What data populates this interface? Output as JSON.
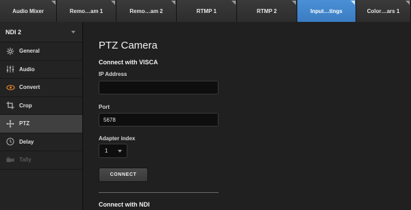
{
  "tabs": [
    {
      "label": "Audio Mixer",
      "active": false
    },
    {
      "label": "Remo…am 1",
      "active": false
    },
    {
      "label": "Remo…am 2",
      "active": false
    },
    {
      "label": "RTMP 1",
      "active": false
    },
    {
      "label": "RTMP 2",
      "active": false
    },
    {
      "label": "Input…tings",
      "active": true
    },
    {
      "label": "Color…ars 1",
      "active": false
    }
  ],
  "sidebar": {
    "source": "NDI 2",
    "items": [
      {
        "label": "General",
        "icon": "gear-icon"
      },
      {
        "label": "Audio",
        "icon": "audio-sliders-icon"
      },
      {
        "label": "Convert",
        "icon": "convert-icon"
      },
      {
        "label": "Crop",
        "icon": "crop-icon"
      },
      {
        "label": "PTZ",
        "icon": "ptz-move-icon",
        "active": true
      },
      {
        "label": "Delay",
        "icon": "clock-icon"
      },
      {
        "label": "Tally",
        "icon": "camera-icon",
        "disabled": true
      }
    ]
  },
  "main": {
    "title": "PTZ Camera",
    "visca_heading": "Connect with VISCA",
    "ip_label": "IP Address",
    "ip_value": "",
    "port_label": "Port",
    "port_value": "5678",
    "adapter_label": "Adapter index",
    "adapter_value": "1",
    "connect_label": "CONNECT",
    "ndi_heading": "Connect with NDI"
  },
  "colors": {
    "accent": "#4a90d6",
    "convert_icon": "#e0822a",
    "background": "#202020"
  }
}
